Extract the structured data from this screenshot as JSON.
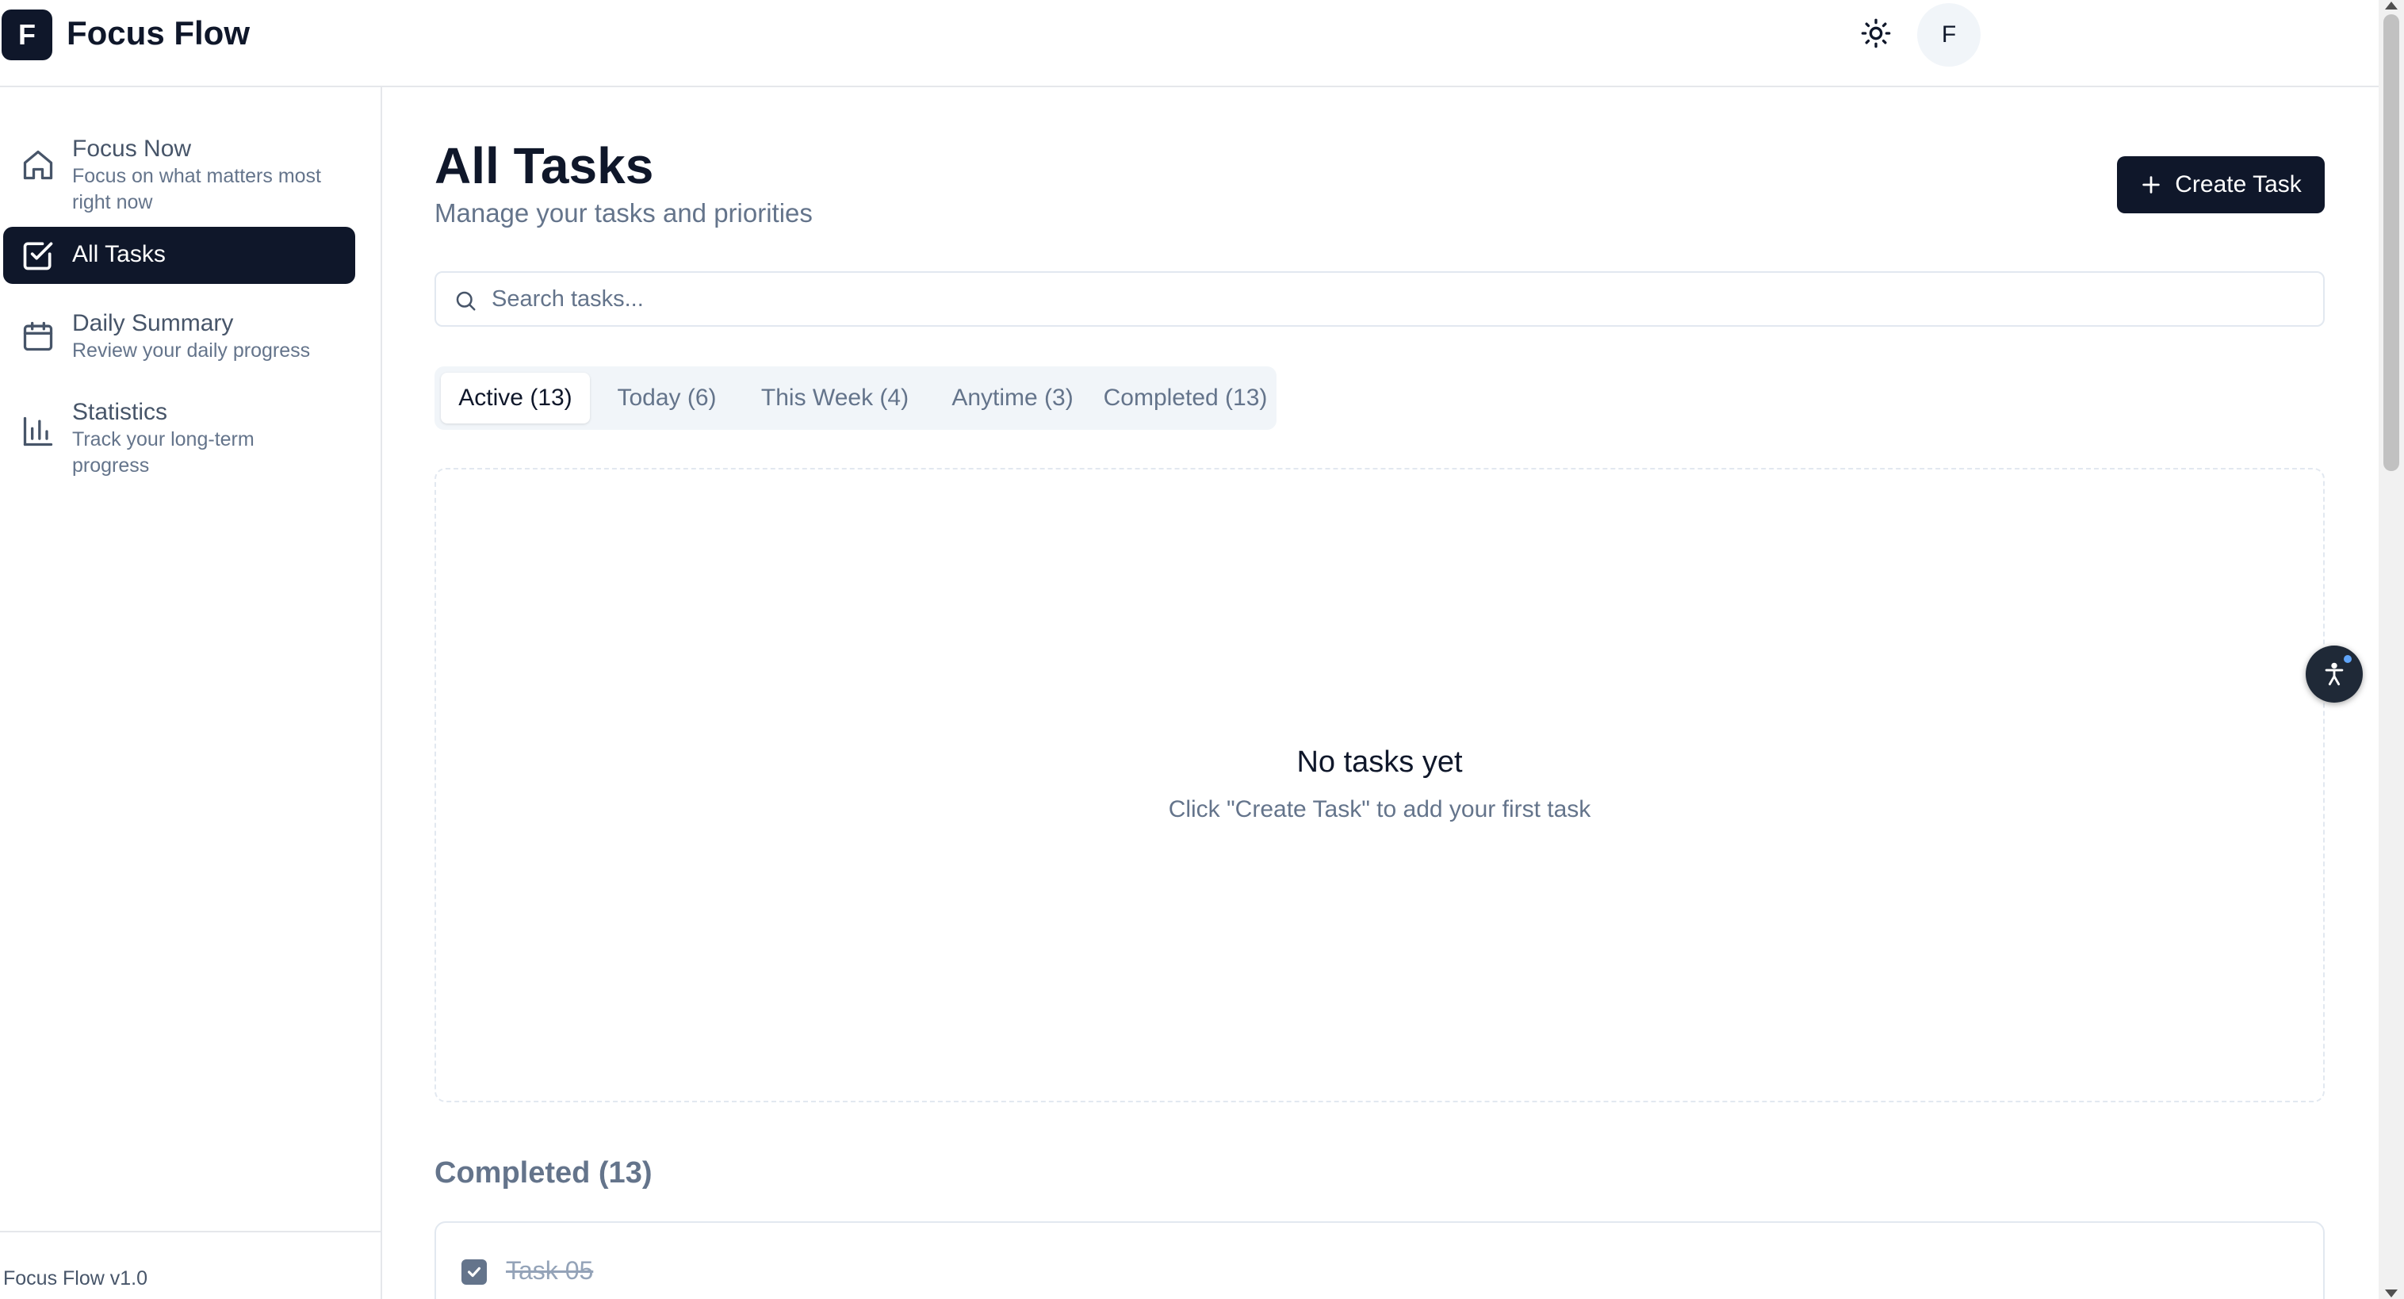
{
  "app": {
    "logo_letter": "F",
    "title": "Focus Flow"
  },
  "header": {
    "avatar_letter": "F",
    "theme_icon": "sun-icon"
  },
  "sidebar": {
    "items": [
      {
        "label": "Focus Now",
        "description": "Focus on what matters most right now",
        "icon": "home-icon",
        "active": false
      },
      {
        "label": "All Tasks",
        "description": "",
        "icon": "check-square-icon",
        "active": true
      },
      {
        "label": "Daily Summary",
        "description": "Review your daily progress",
        "icon": "calendar-icon",
        "active": false
      },
      {
        "label": "Statistics",
        "description": "Track your long-term progress",
        "icon": "bar-chart-icon",
        "active": false
      }
    ],
    "footer": "Focus Flow v1.0"
  },
  "main": {
    "title": "All Tasks",
    "subtitle": "Manage your tasks and priorities",
    "create_button": "Create Task",
    "search": {
      "placeholder": "Search tasks...",
      "value": ""
    },
    "tabs": [
      {
        "label": "Active (13)",
        "active": true
      },
      {
        "label": "Today (6)",
        "active": false
      },
      {
        "label": "This Week (4)",
        "active": false
      },
      {
        "label": "Anytime (3)",
        "active": false
      },
      {
        "label": "Completed (13)",
        "active": false
      }
    ],
    "empty_state": {
      "title": "No tasks yet",
      "description": "Click \"Create Task\" to add your first task"
    },
    "completed_section": {
      "heading": "Completed (13)",
      "tasks": [
        {
          "name": "Task 05",
          "checked": true
        }
      ]
    }
  },
  "colors": {
    "primary": "#0f172a",
    "muted": "#64748b",
    "border": "#e2e8f0",
    "accent_dot": "#60a5fa"
  }
}
